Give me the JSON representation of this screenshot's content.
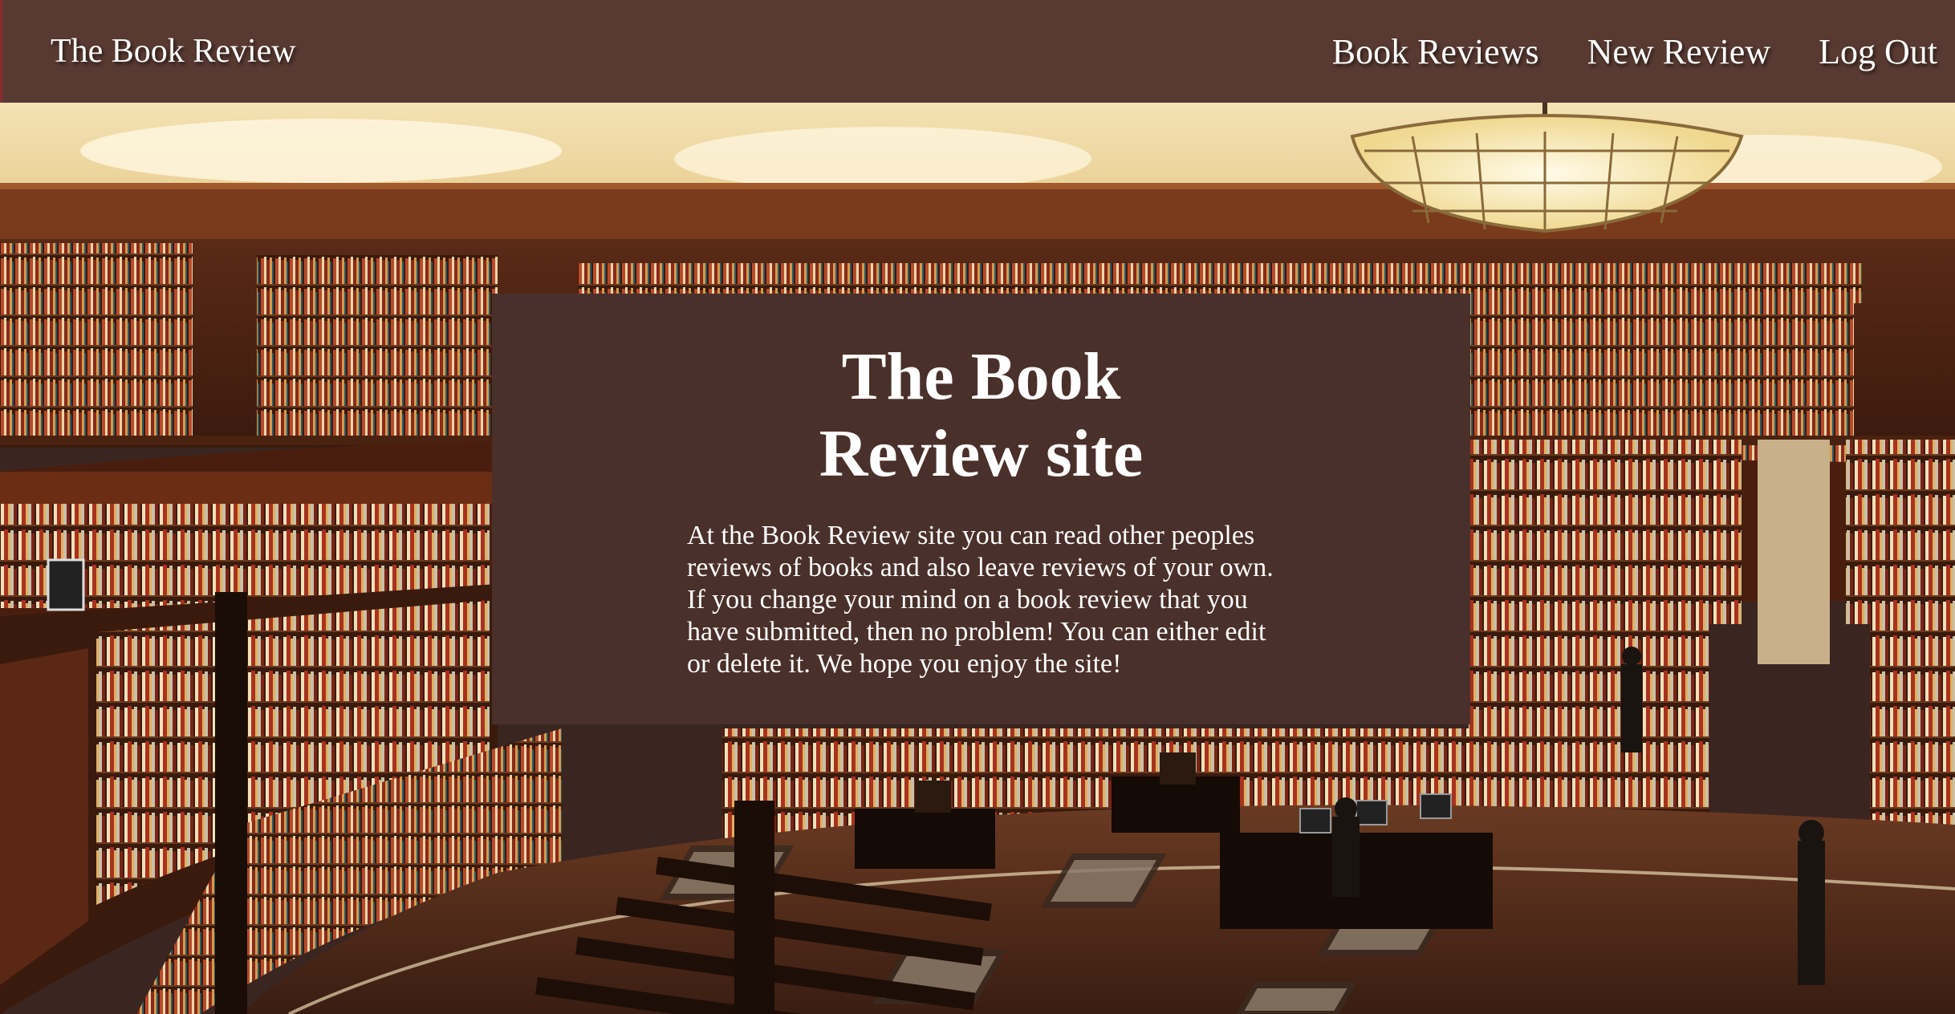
{
  "header": {
    "brand": "The Book Review",
    "links": [
      {
        "label": "Book Reviews"
      },
      {
        "label": "New Review"
      },
      {
        "label": "Log Out"
      }
    ]
  },
  "hero": {
    "background_image": "library interior with bookshelves",
    "title": "The Book Review site",
    "body": "At the Book Review site you can read other peoples reviews of books and also leave reviews of your own. If you change your mind on a book review that you have submitted, then no problem! You can either edit or delete it. We hope you enjoy the site!"
  },
  "colors": {
    "navbar": "#583a32",
    "panel": "#4a302a",
    "text": "#ffffff"
  }
}
